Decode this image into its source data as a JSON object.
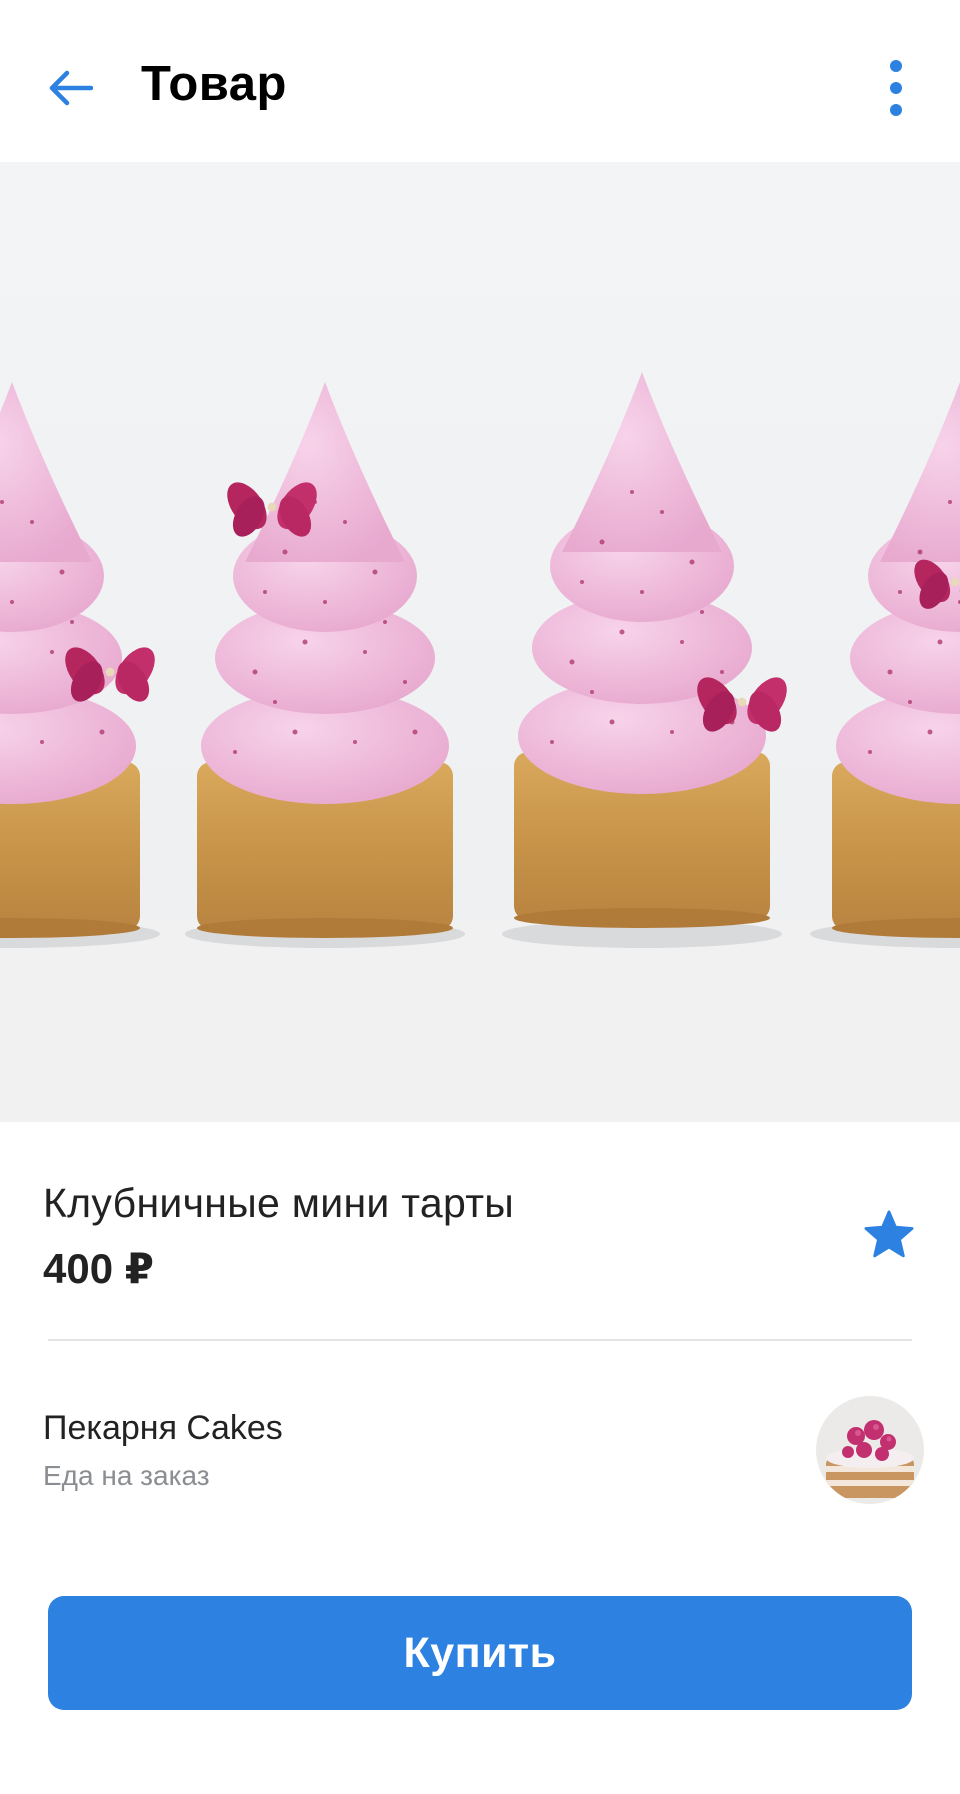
{
  "header": {
    "title": "Товар",
    "back_icon": "arrow-left-icon",
    "menu_icon": "more-vertical-icon"
  },
  "product": {
    "image_alt": "Клубничные мини тарты",
    "title": "Клубничные мини тарты",
    "price": "400 ₽",
    "favorite_icon": "star-icon",
    "favorited": true
  },
  "seller": {
    "name": "Пекарня Cakes",
    "description": "Еда на заказ",
    "avatar_icon": "avatar"
  },
  "actions": {
    "buy_label": "Купить"
  },
  "colors": {
    "accent": "#2d81e0",
    "text_primary": "#222222",
    "text_secondary": "#8a8d91",
    "divider": "#e3e4e6"
  }
}
